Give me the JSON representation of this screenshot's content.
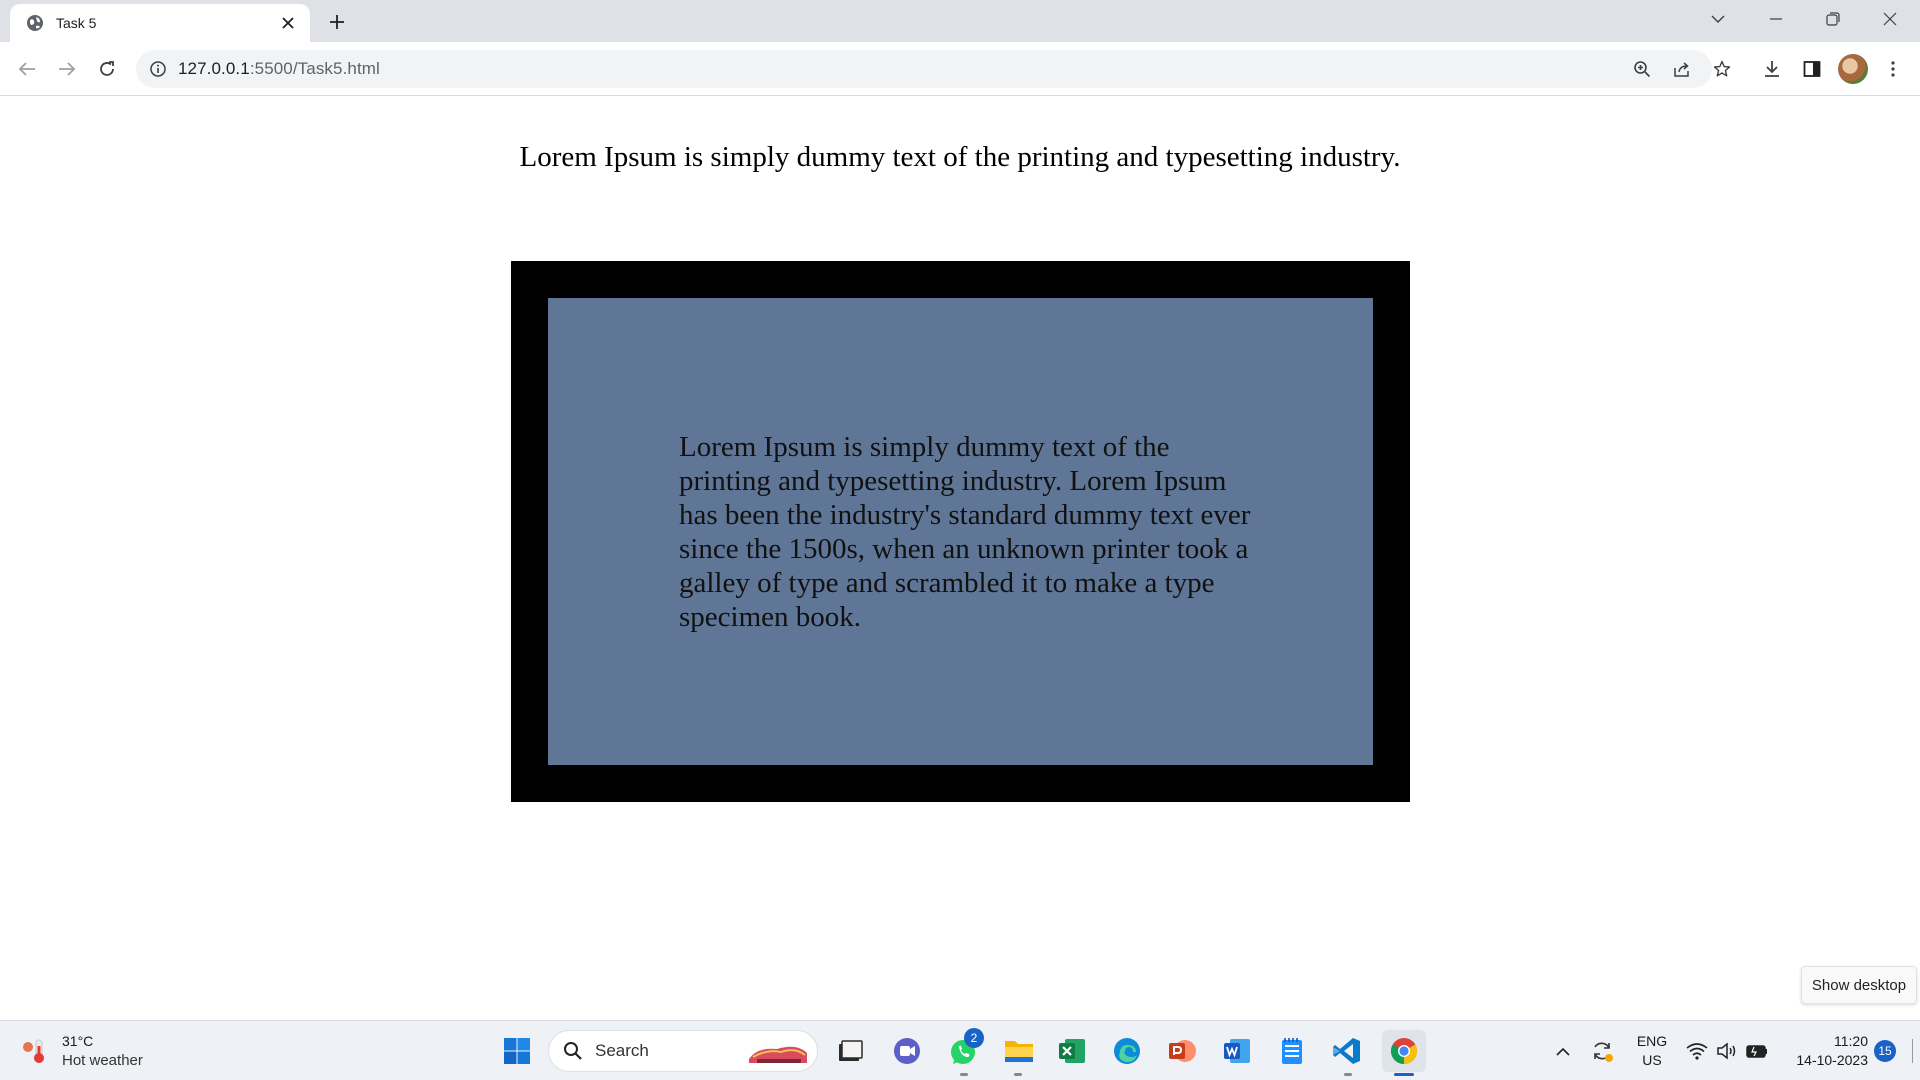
{
  "browser": {
    "tab": {
      "title": "Task 5"
    },
    "address_bar": {
      "url_host": "127.0.0.1",
      "url_rest": ":5500/Task5.html"
    }
  },
  "page": {
    "heading": "Lorem Ipsum is simply dummy text of the printing and typesetting industry.",
    "body_paragraph": "Lorem Ipsum is simply dummy text of the printing and typesetting industry. Lorem Ipsum has been the industry's standard dummy text ever since the 1500s, when an unknown printer took a galley of type and scrambled it to make a type specimen book.",
    "box_colors": {
      "outer": "#000000",
      "inner": "#5f7696"
    }
  },
  "tooltip": {
    "show_desktop": "Show desktop"
  },
  "taskbar": {
    "weather": {
      "temp": "31°C",
      "description": "Hot weather"
    },
    "search": {
      "label": "Search"
    },
    "apps": [
      "start-icon",
      "search-icon",
      "task-view-icon",
      "teams-chat-icon",
      "whatsapp-icon",
      "file-explorer-icon",
      "excel-icon",
      "edge-icon",
      "powerpoint-icon",
      "word-icon",
      "notepad-icon",
      "vscode-icon",
      "chrome-icon"
    ],
    "whatsapp_badge": "2",
    "language": {
      "line1": "ENG",
      "line2": "US"
    },
    "clock": {
      "time": "11:20",
      "date": "14-10-2023"
    },
    "notification_count": "15"
  }
}
